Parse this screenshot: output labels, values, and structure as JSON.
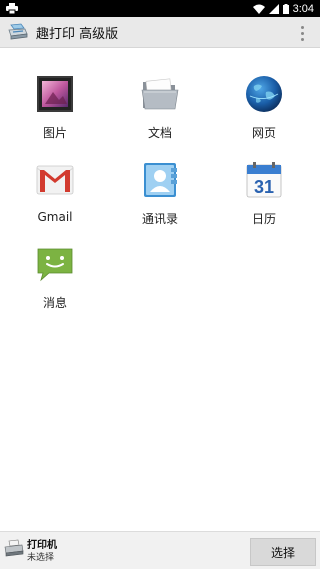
{
  "status_bar": {
    "time": "3:04"
  },
  "app_bar": {
    "title": "趣打印 高级版"
  },
  "apps": [
    {
      "label": "图片",
      "icon": "photo-gallery-icon"
    },
    {
      "label": "文档",
      "icon": "folder-icon"
    },
    {
      "label": "网页",
      "icon": "globe-icon"
    },
    {
      "label": "Gmail",
      "icon": "gmail-icon"
    },
    {
      "label": "通讯录",
      "icon": "contacts-icon"
    },
    {
      "label": "日历",
      "icon": "calendar-icon"
    },
    {
      "label": "消息",
      "icon": "message-icon"
    }
  ],
  "calendar_day": "31",
  "bottom_bar": {
    "printer_title": "打印机",
    "printer_status": "未选择",
    "select_label": "选择"
  },
  "colors": {
    "app_bar": "#e9e9e9",
    "bottom_bar": "#f1f1f1",
    "button": "#d9d9d9"
  }
}
